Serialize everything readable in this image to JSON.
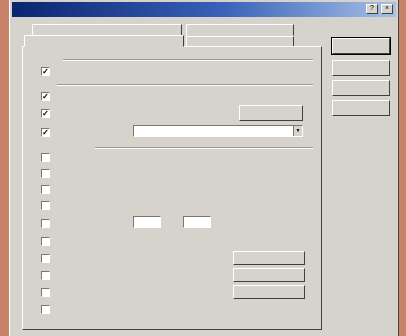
{
  "window": {
    "title": "",
    "btn_help": "?",
    "btn_close": "×"
  },
  "tabs": {
    "back_row": [
      "",
      ""
    ],
    "front_row": [
      "",
      ""
    ],
    "active_index": 0
  },
  "group1": {
    "title": "",
    "opt_main": {
      "label": "",
      "checked": true
    }
  },
  "group2": {
    "title": "",
    "opt_a": {
      "label": "",
      "checked": true
    },
    "opt_b": {
      "label": "",
      "checked": true,
      "button": ""
    },
    "opt_c": {
      "label": "",
      "checked": true,
      "value": ""
    }
  },
  "group3": {
    "title": "",
    "items": [
      {
        "label": "",
        "checked": false
      },
      {
        "label": "",
        "checked": false
      },
      {
        "label": "",
        "checked": false
      },
      {
        "label": "",
        "checked": false
      },
      {
        "label": "",
        "checked": false,
        "spin1": "",
        "spin2": "",
        "after": "",
        "between": ""
      },
      {
        "label": "",
        "checked": false
      },
      {
        "label": "",
        "checked": false,
        "field": ""
      },
      {
        "label": "",
        "checked": false,
        "field": ""
      },
      {
        "label": "",
        "checked": false,
        "field": ""
      },
      {
        "label": "",
        "checked": false
      }
    ]
  },
  "side_buttons": {
    "ok": "",
    "cancel": "",
    "apply": "",
    "help": ""
  }
}
